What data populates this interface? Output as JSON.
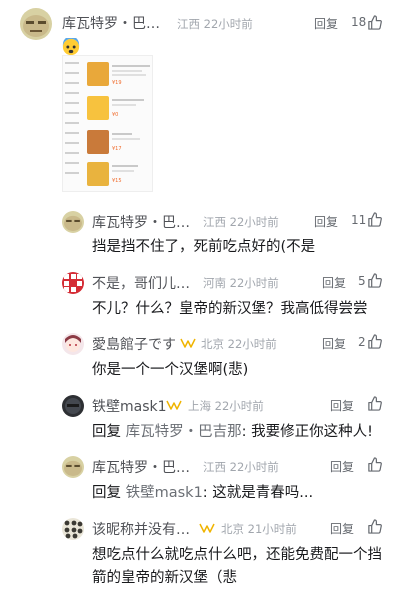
{
  "comments": [
    {
      "username": "库瓦特罗・巴…",
      "location": "江西 22小时前",
      "reply_label": "回复",
      "likes": "18",
      "emoji": "fearful-face-emoji"
    },
    {
      "username": "库瓦特罗・巴…",
      "location": "江西 22小时前",
      "reply_label": "回复",
      "likes": "11",
      "text": "挡是挡不住了，死前吃点好的(不是"
    },
    {
      "username": "不是，哥们儿…",
      "location": "河南 22小时前",
      "reply_label": "回复",
      "likes": "5",
      "text": "不儿？什么？皇帝的新汉堡？我高低得尝尝"
    },
    {
      "username": "愛島館子です",
      "location": "北京 22小时前",
      "reply_label": "回复",
      "likes": "2",
      "text": "你是一个一个汉堡啊(悲)"
    },
    {
      "username": "铁壁mask1",
      "location": "上海 22小时前",
      "reply_label": "回复",
      "likes": "",
      "reply_prefix": "回复 ",
      "mention": "库瓦特罗・巴吉那",
      "text": ": 我要修正你这种人!"
    },
    {
      "username": "库瓦特罗・巴…",
      "location": "江西 22小时前",
      "reply_label": "回复",
      "likes": "",
      "reply_prefix": "回复 ",
      "mention": "铁壁mask1",
      "text": ": 这就是青春吗..."
    },
    {
      "username": "该昵称并没有…",
      "location": "北京 21小时前",
      "reply_label": "回复",
      "likes": "",
      "text_line1": "想吃点什么就吃点什么吧，还能免费配一个挡",
      "text_line2": "箭的皇帝的新汉堡（悲"
    }
  ],
  "food_items": [
    {
      "price": "¥19"
    },
    {
      "price": "¥0"
    },
    {
      "price": "¥17"
    },
    {
      "price": "¥15"
    }
  ],
  "colors": {
    "text": "#18191c",
    "meta": "#a1a6ad",
    "username": "#505257",
    "level_gold": "#f0b400"
  }
}
